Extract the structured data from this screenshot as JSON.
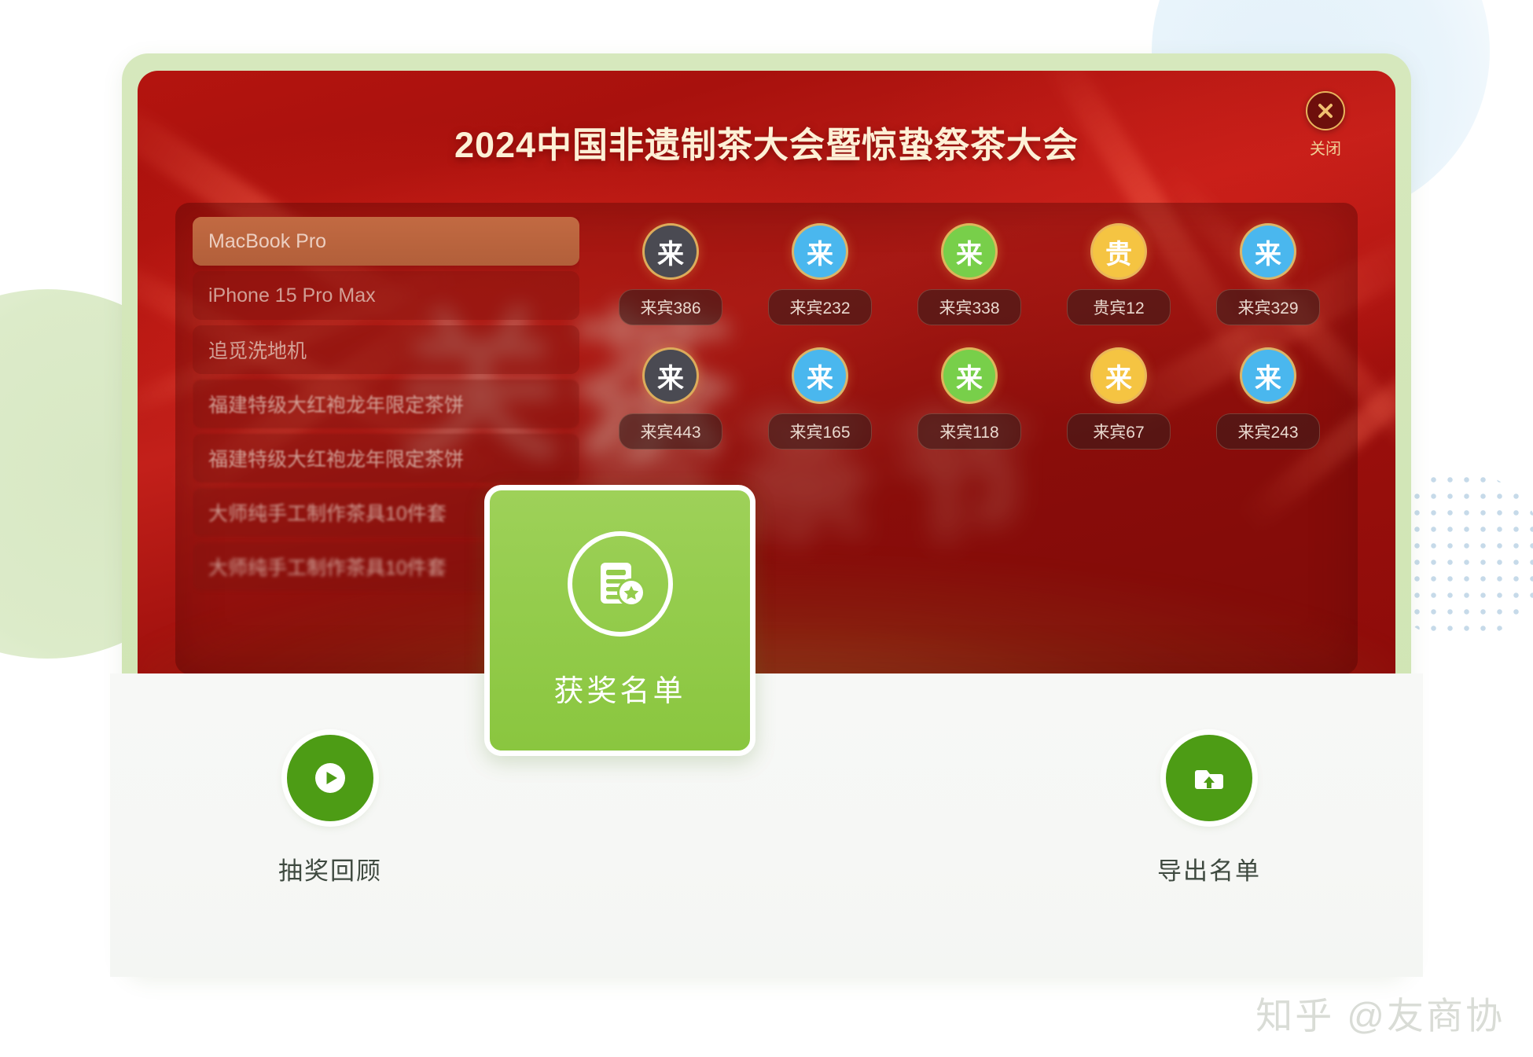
{
  "stage": {
    "title": "2024中国非遗制茶大会暨惊蛰祭茶大会",
    "close_label": "关闭",
    "close_icon": "close-x-icon",
    "decor_text_1": "关茶",
    "decor_text_2": "祭茶节"
  },
  "prizes": {
    "items": [
      {
        "label": "MacBook Pro",
        "selected": true
      },
      {
        "label": "iPhone 15 Pro Max",
        "selected": false
      },
      {
        "label": "追觅洗地机",
        "selected": false
      },
      {
        "label": "福建特级大红袍龙年限定茶饼",
        "selected": false
      },
      {
        "label": "福建特级大红袍龙年限定茶饼",
        "selected": false
      },
      {
        "label": "大师纯手工制作茶具10件套",
        "selected": false
      },
      {
        "label": "大师纯手工制作茶具10件套",
        "selected": false
      }
    ]
  },
  "guests": {
    "rows": [
      [
        {
          "char": "来",
          "name": "来宾386",
          "color": "#4a4a52"
        },
        {
          "char": "来",
          "name": "来宾232",
          "color": "#4ab7ee"
        },
        {
          "char": "来",
          "name": "来宾338",
          "color": "#78cf4a"
        },
        {
          "char": "贵",
          "name": "贵宾12",
          "color": "#f5c442"
        },
        {
          "char": "来",
          "name": "来宾329",
          "color": "#4ab7ee"
        }
      ],
      [
        {
          "char": "来",
          "name": "来宾443",
          "color": "#4a4a52"
        },
        {
          "char": "来",
          "name": "来宾165",
          "color": "#4ab7ee"
        },
        {
          "char": "来",
          "name": "来宾118",
          "color": "#78cf4a"
        },
        {
          "char": "来",
          "name": "来宾67",
          "color": "#f5c442"
        },
        {
          "char": "来",
          "name": "来宾243",
          "color": "#4ab7ee"
        }
      ]
    ]
  },
  "toolbar": {
    "replay_label": "抽奖回顾",
    "replay_icon": "play-circle-icon",
    "winners_label": "获奖名单",
    "winners_icon": "award-list-icon",
    "export_label": "导出名单",
    "export_icon": "folder-upload-icon"
  },
  "watermark": {
    "text": "知乎 @友商协"
  },
  "colors": {
    "brand_green": "#8ac63f",
    "button_green": "#4d9c15",
    "stage_red": "#a8110d",
    "gold": "#e8b45c"
  }
}
